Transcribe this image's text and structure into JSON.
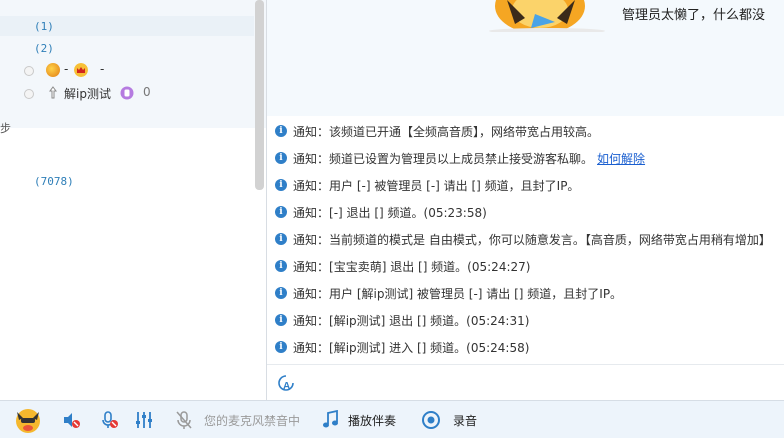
{
  "left_panel": {
    "edge_char": "步",
    "groups": [
      {
        "label": "(1)"
      },
      {
        "label": "(2)"
      },
      {
        "label": "(7078)"
      }
    ],
    "users": [
      {
        "name": "-",
        "suffix": "-",
        "icon": "user-level-icon",
        "badge": "crown-icon"
      },
      {
        "name": "解ip测试",
        "suffix": "0",
        "icon": "guest-icon",
        "badge": "vip-badge-icon"
      }
    ]
  },
  "top_right": {
    "admin_message": "管理员太懒了，什么都没"
  },
  "messages": {
    "prefix": "通知：",
    "items": [
      {
        "text": "该频道已开通【全频高音质】，网络带宽占用较高。"
      },
      {
        "text": "频道已设置为管理员以上成员禁止接受游客私聊。",
        "link": "如何解除"
      },
      {
        "text": "用户 [-] 被管理员 [-] 请出 [] 频道，且封了IP。"
      },
      {
        "text": " [-] 退出 [] 频道。(05:23:58)"
      },
      {
        "text": "当前频道的模式是 自由模式，你可以随意发言。【高音质，网络带宽占用稍有增加】"
      },
      {
        "text": " [宝宝卖萌] 退出 [] 频道。(05:24:27)"
      },
      {
        "text": "用户 [解ip测试] 被管理员 [-] 请出 [] 频道，且封了IP。"
      },
      {
        "text": " [解ip测试] 退出 [] 频道。(05:24:31)"
      },
      {
        "text": " [解ip测试] 进入 [] 频道。(05:24:58)"
      }
    ]
  },
  "toolbar": {
    "mic_status": "您的麦克风禁音中",
    "play_accompaniment": "播放伴奏",
    "record": "录音"
  },
  "colors": {
    "accent_blue": "#2f7fc8",
    "link_blue": "#1a5fd0",
    "toolbar_bg": "#edf4fb",
    "disabled_text": "#9a9a9a"
  }
}
